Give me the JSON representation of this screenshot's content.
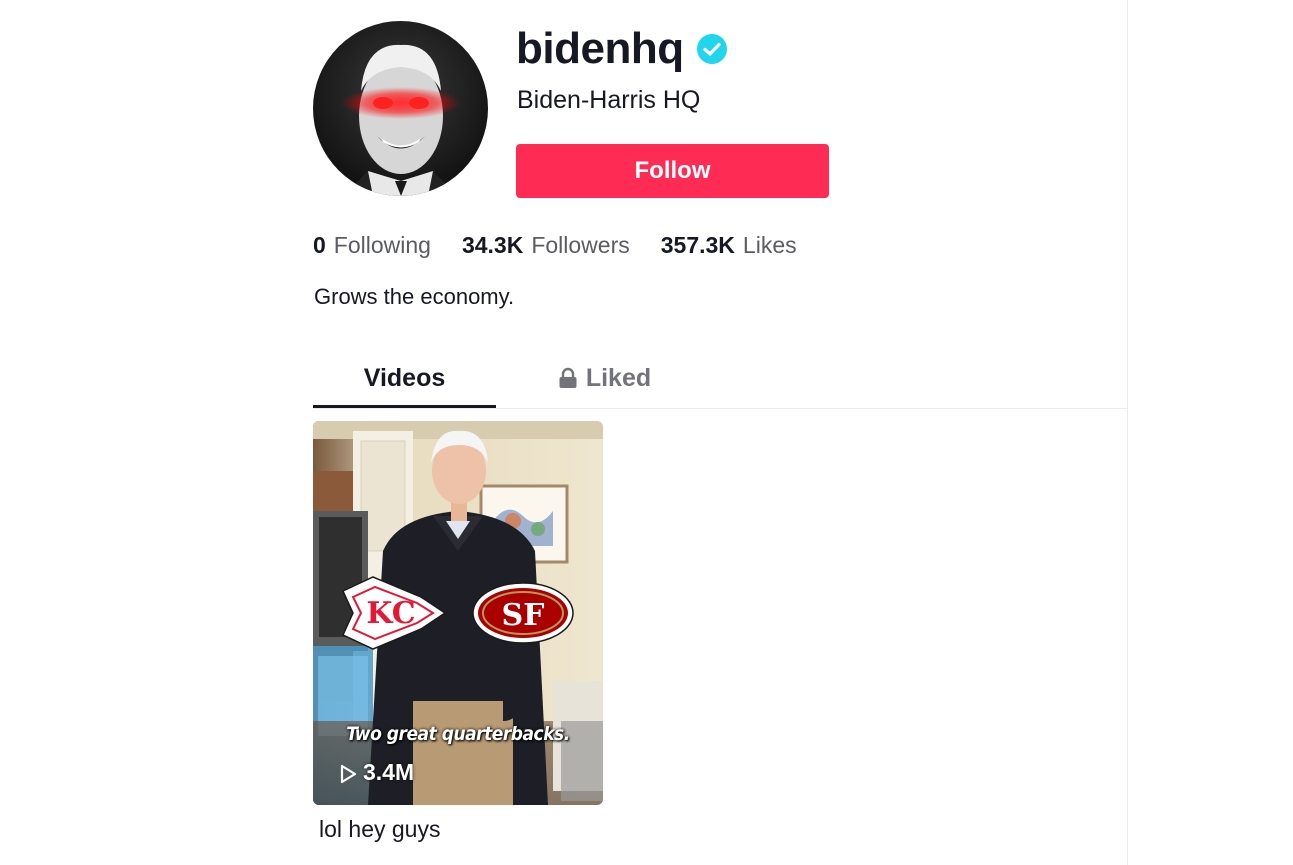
{
  "colors": {
    "accent": "#fe2c55",
    "verified": "#20d5ec",
    "text_primary": "#161823",
    "text_secondary": "#5b5c63"
  },
  "profile": {
    "username": "bidenhq",
    "nickname": "Biden-Harris HQ",
    "verified_icon": "verified-badge-icon",
    "follow_label": "Follow",
    "bio": "Grows the economy."
  },
  "stats": [
    {
      "value": "0",
      "label": "Following"
    },
    {
      "value": "34.3K",
      "label": "Followers"
    },
    {
      "value": "357.3K",
      "label": "Likes"
    }
  ],
  "tabs": {
    "videos": "Videos",
    "liked": "Liked",
    "liked_icon": "lock-icon"
  },
  "videos": [
    {
      "overlay_text": "Two great quarterbacks.",
      "views": "3.4M",
      "view_icon": "play-icon",
      "description": "lol hey guys"
    }
  ]
}
